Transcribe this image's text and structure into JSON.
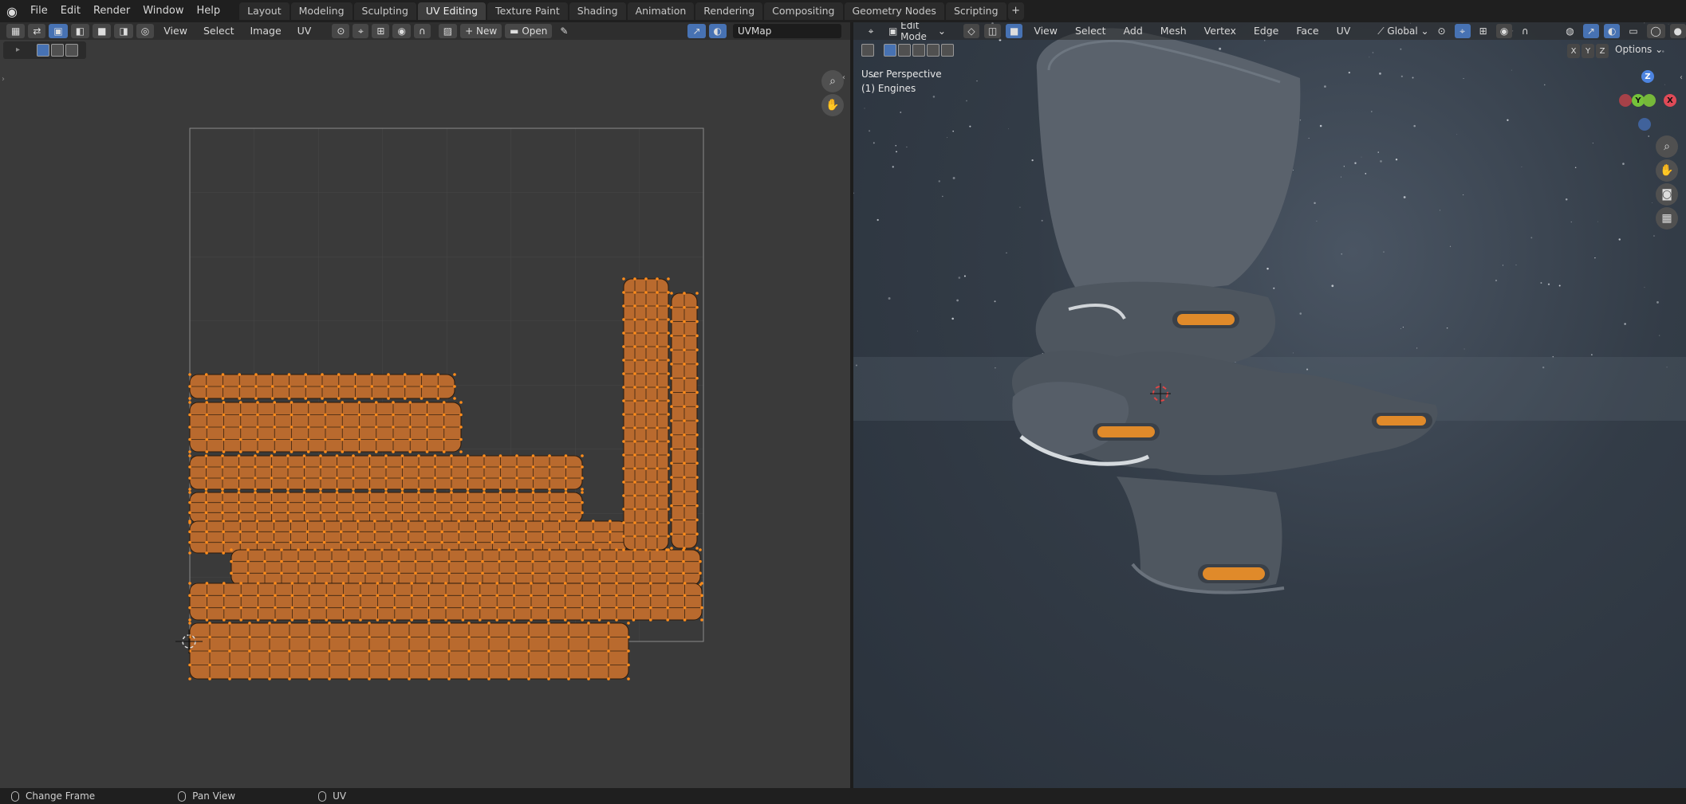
{
  "menu": [
    "File",
    "Edit",
    "Render",
    "Window",
    "Help"
  ],
  "workspaces": [
    "Layout",
    "Modeling",
    "Sculpting",
    "UV Editing",
    "Texture Paint",
    "Shading",
    "Animation",
    "Rendering",
    "Compositing",
    "Geometry Nodes",
    "Scripting"
  ],
  "active_workspace": "UV Editing",
  "uv_editor": {
    "menus": [
      "View",
      "Select",
      "Image",
      "UV"
    ],
    "new_label": "New",
    "open_label": "Open",
    "uv_map": "UVMap"
  },
  "viewport": {
    "mode": "Edit Mode",
    "menus": [
      "View",
      "Select",
      "Add",
      "Mesh",
      "Vertex",
      "Edge",
      "Face",
      "UV"
    ],
    "orientation": "Global",
    "options_label": "Options",
    "perspective": "User Perspective",
    "object": "(1) Engines",
    "axes": [
      "X",
      "Y",
      "Z"
    ]
  },
  "statusbar": [
    "Change Frame",
    "Pan View",
    "UV"
  ],
  "colors": {
    "accent": "#4772b3",
    "uv_fill": "#b96a2e",
    "vertex": "#ff8c1a"
  }
}
